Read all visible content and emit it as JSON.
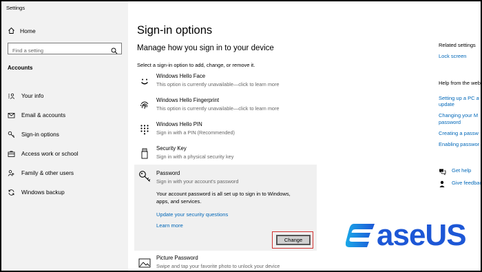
{
  "app": {
    "title": "Settings"
  },
  "sidebar": {
    "home": "Home",
    "search_placeholder": "Find a setting",
    "section": "Accounts",
    "items": [
      {
        "label": "Your info",
        "icon": "person-card-icon"
      },
      {
        "label": "Email & accounts",
        "icon": "mail-icon"
      },
      {
        "label": "Sign-in options",
        "icon": "key-icon"
      },
      {
        "label": "Access work or school",
        "icon": "briefcase-icon"
      },
      {
        "label": "Family & other users",
        "icon": "people-icon"
      },
      {
        "label": "Windows backup",
        "icon": "sync-icon"
      }
    ]
  },
  "main": {
    "title": "Sign-in options",
    "subtitle": "Manage how you sign in to your device",
    "instruction": "Select a sign-in option to add, change, or remove it.",
    "options": [
      {
        "name": "Windows Hello Face",
        "desc": "This option is currently unavailable—click to learn more",
        "icon": "face-icon"
      },
      {
        "name": "Windows Hello Fingerprint",
        "desc": "This option is currently unavailable—click to learn more",
        "icon": "fingerprint-icon"
      },
      {
        "name": "Windows Hello PIN",
        "desc": "Sign in with a PIN (Recommended)",
        "icon": "pin-keypad-icon"
      },
      {
        "name": "Security Key",
        "desc": "Sign in with a physical security key",
        "icon": "usb-key-icon"
      }
    ],
    "password": {
      "name": "Password",
      "desc": "Sign in with your account's password",
      "info": "Your account password is all set up to sign in to Windows, apps, and services.",
      "link_questions": "Update your security questions",
      "link_learn": "Learn more",
      "button": "Change"
    },
    "picture_password": {
      "name": "Picture Password",
      "desc": "Swipe and tap your favorite photo to unlock your device"
    }
  },
  "right": {
    "related_heading": "Related settings",
    "related_link": "Lock screen",
    "help_heading": "Help from the web",
    "help_links": [
      "Setting up a PC a",
      "update",
      "Changing your M",
      "password",
      "Creating a passw",
      "Enabling passwor"
    ],
    "get_help": "Get help",
    "give_feedback": "Give feedback"
  },
  "logo": {
    "text": "aseUS",
    "brand_color": "#1d57d6",
    "accent_color": "#1aa8e8"
  },
  "colors": {
    "link": "#0067b8",
    "sidebar_bg": "#f2f2f2",
    "highlight": "#d0302e"
  }
}
